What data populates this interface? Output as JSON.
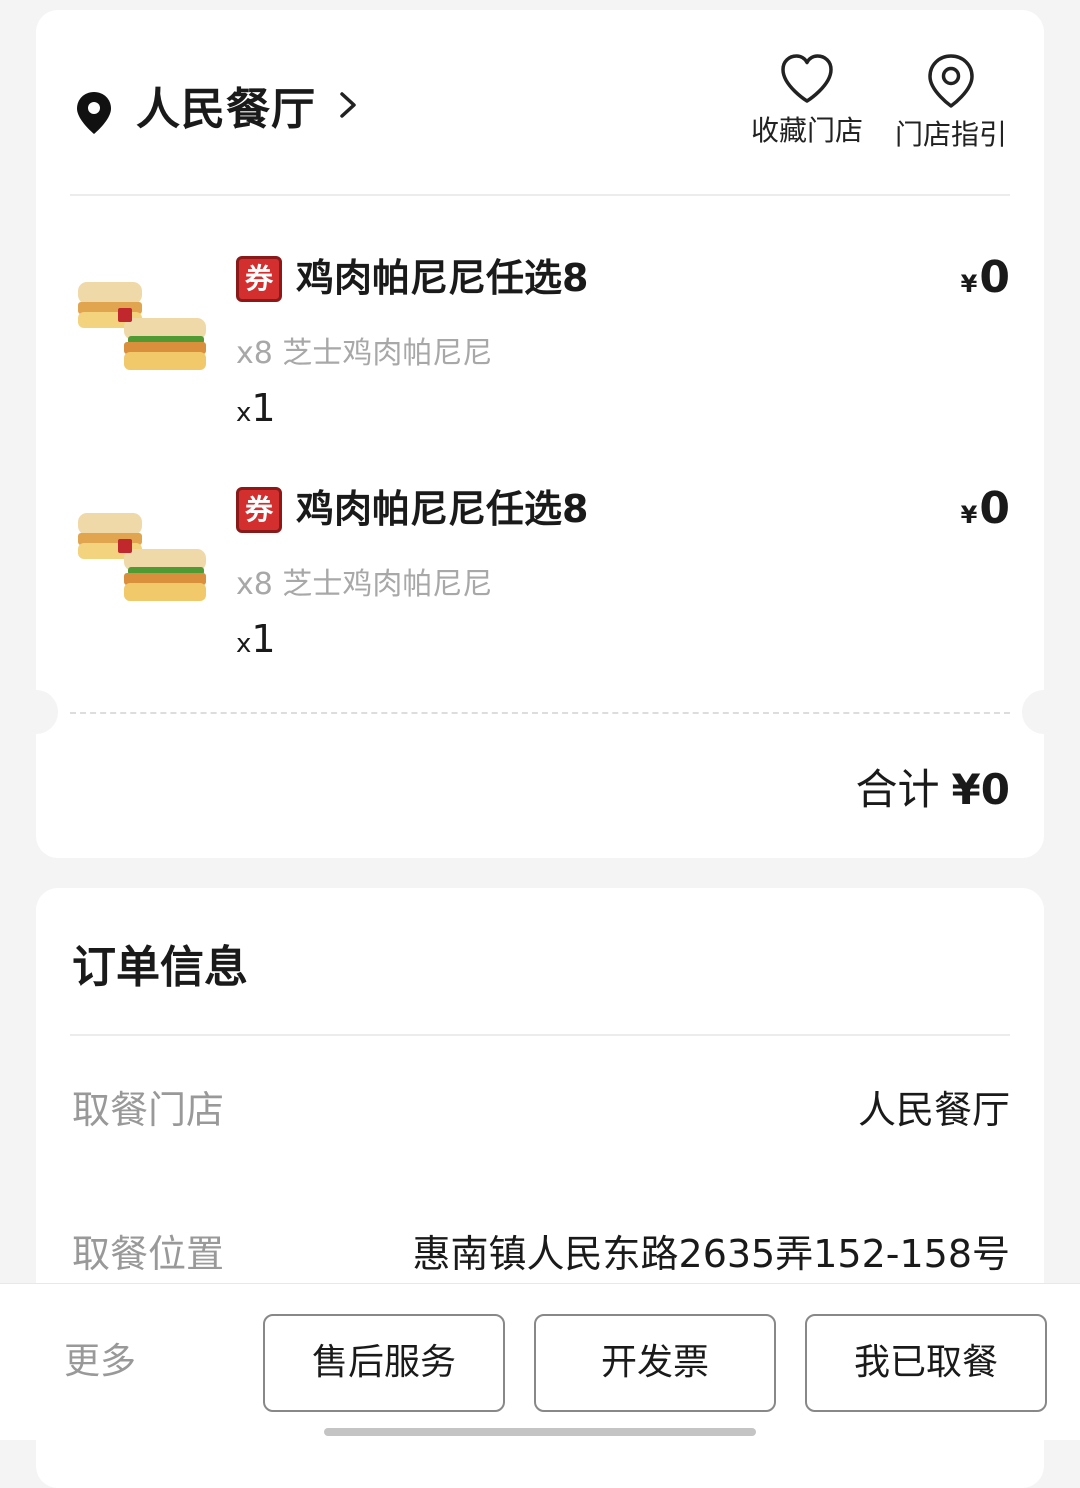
{
  "store": {
    "name": "人民餐厅",
    "actions": [
      {
        "label": "收藏门店",
        "icon": "heart-icon"
      },
      {
        "label": "门店指引",
        "icon": "location-pin-icon"
      }
    ]
  },
  "items": [
    {
      "badge": "券",
      "name": "鸡肉帕尼尼任选8",
      "sub": "x8 芝士鸡肉帕尼尼",
      "qty_prefix": "x",
      "qty": "1",
      "currency": "¥",
      "price": "0"
    },
    {
      "badge": "券",
      "name": "鸡肉帕尼尼任选8",
      "sub": "x8 芝士鸡肉帕尼尼",
      "qty_prefix": "x",
      "qty": "1",
      "currency": "¥",
      "price": "0"
    }
  ],
  "total": {
    "label": "合计",
    "amount": "¥0"
  },
  "order_info": {
    "title": "订单信息",
    "rows": [
      {
        "key": "取餐门店",
        "value": "人民餐厅"
      },
      {
        "key": "取餐位置",
        "value": "惠南镇人民东路2635弄152-158号"
      }
    ]
  },
  "bottom_bar": {
    "more": "更多",
    "buttons": [
      "售后服务",
      "开发票",
      "我已取餐"
    ]
  },
  "colors": {
    "badge": "#d32f2f",
    "text": "#1a1a1a",
    "muted": "#999999",
    "background": "#f4f4f4"
  }
}
